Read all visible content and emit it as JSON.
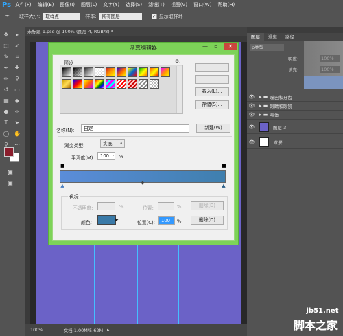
{
  "app": {
    "logo": "Ps",
    "menu": [
      "文件(F)",
      "编辑(E)",
      "图像(I)",
      "图层(L)",
      "文字(Y)",
      "选择(S)",
      "滤镜(T)",
      "视图(V)",
      "窗口(W)",
      "帮助(H)"
    ]
  },
  "options": {
    "sample_size_label": "取样大小:",
    "sample_size_value": "取样点",
    "sample_label": "样本:",
    "sample_value": "所有图层",
    "show_ring_label": "显示取样环"
  },
  "document": {
    "tab_title": "未标题-1.psd @ 100% (图层 4, RGB/8) *",
    "zoom": "100%",
    "doc_info": "文档:1.00M/5.62M"
  },
  "layers_panel": {
    "tabs": [
      "图层",
      "通道",
      "路径"
    ],
    "kind_label": "ρ类型",
    "opacity_label": "明度:",
    "opacity_value": "100%",
    "fill_label": "填充:",
    "fill_value": "100%",
    "layers": [
      {
        "name": "嘴巴和牙齿",
        "type": "group"
      },
      {
        "name": "眼睛和眼镜",
        "type": "group"
      },
      {
        "name": "身体",
        "type": "group"
      },
      {
        "name": "图层 3",
        "type": "layer",
        "color": "#6b62c7"
      },
      {
        "name": "背景",
        "type": "layer",
        "color": "#ffffff"
      }
    ]
  },
  "dialog": {
    "title": "渐变编辑器",
    "presets_label": "预设",
    "buttons": {
      "load": "载入(L)...",
      "save": "存储(S)...",
      "new": "新建(W)",
      "delete_opacity": "删除(D)",
      "delete_color": "删除(D)"
    },
    "name_label": "名称(N):",
    "name_value": "自定",
    "gradient_type_label": "渐变类型:",
    "gradient_type_value": "实底",
    "smoothness_label": "平滑度(M):",
    "smoothness_value": "100",
    "percent": "%",
    "stops_group_label": "色标",
    "opacity_label": "不透明度:",
    "location_label": "位置:",
    "color_label": "颜色:",
    "location_color_label": "位置(C):",
    "location_value": "100",
    "gradient_colors": [
      "#5b8dd9",
      "#3f7fae"
    ],
    "color_stop_swatch": "#3a7aa8"
  },
  "watermark": {
    "line1": "jb51.net",
    "line2": "脚本之家"
  },
  "colors": {
    "canvas": "#6b62c7",
    "foreground": "#8b1d2c",
    "background": "#ffffff",
    "dialog_frame": "#7dd358"
  }
}
